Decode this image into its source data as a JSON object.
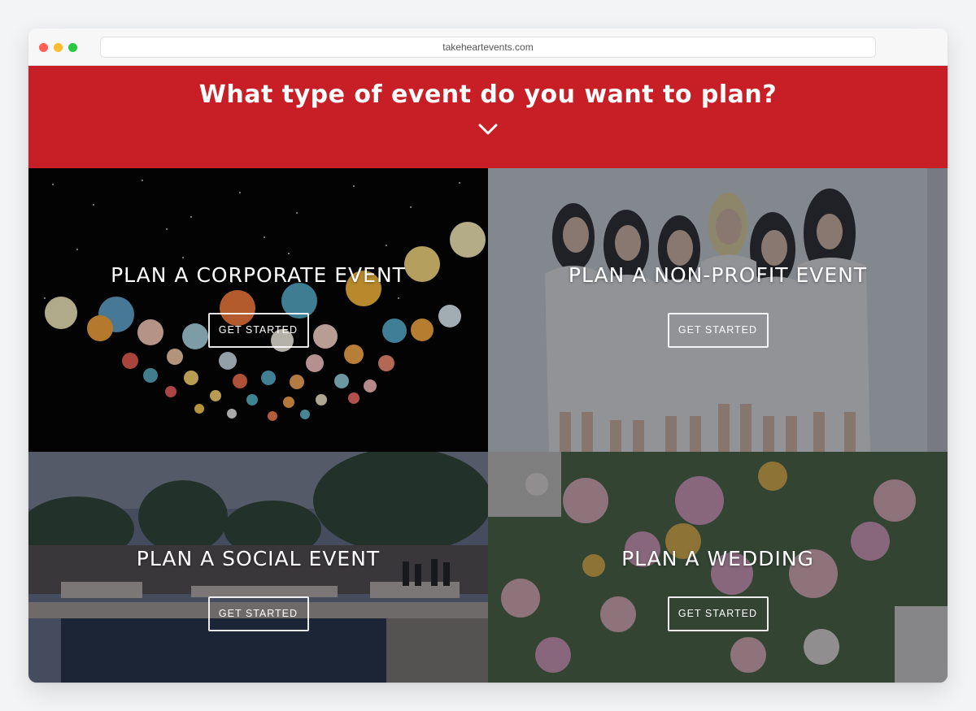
{
  "browser": {
    "url": "takeheartevents.com"
  },
  "banner": {
    "heading": "What type of event do you want to plan?",
    "background": "#c81f27",
    "icon": "chevron-down-icon"
  },
  "tiles": [
    {
      "title": "PLAN A CORPORATE EVENT",
      "cta": "GET STARTED"
    },
    {
      "title": "PLAN A NON-PROFIT EVENT",
      "cta": "GET STARTED"
    },
    {
      "title": "PLAN A SOCIAL EVENT",
      "cta": "GET STARTED"
    },
    {
      "title": "PLAN A WEDDING",
      "cta": "GET STARTED"
    }
  ]
}
